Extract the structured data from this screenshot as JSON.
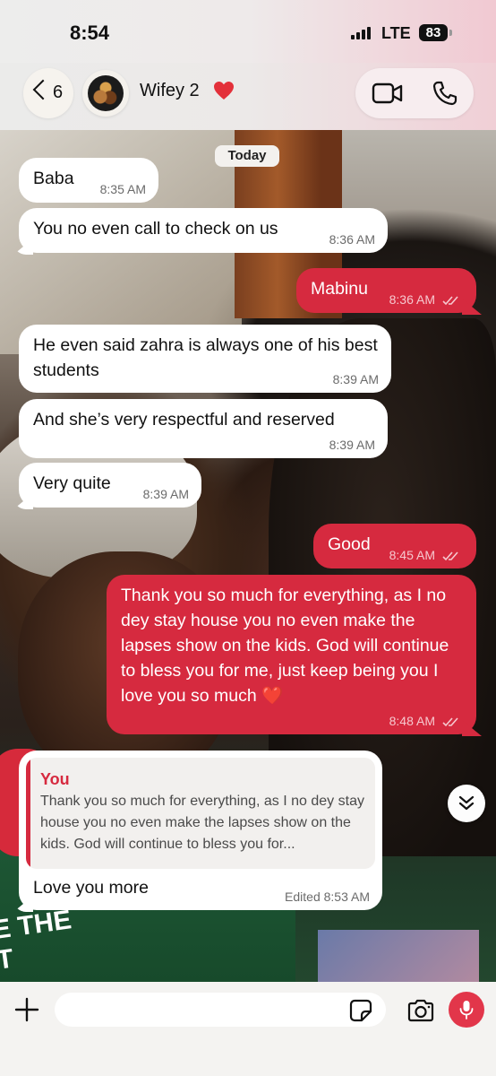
{
  "status_bar": {
    "time": "8:54",
    "network": "LTE",
    "battery": "83"
  },
  "header": {
    "back_count": "6",
    "contact_name": "Wifey 2",
    "icons": {
      "back": "chevron-left-icon",
      "name_emoji": "red-heart-icon",
      "video": "video-camera-icon",
      "call": "phone-icon"
    }
  },
  "chat": {
    "date_label": "Today",
    "messages": [
      {
        "dir": "in",
        "text": "Baba",
        "time": "8:35 AM"
      },
      {
        "dir": "in",
        "text": "You no even call to check on us",
        "time": "8:36 AM"
      },
      {
        "dir": "out",
        "text": "Mabinu",
        "time": "8:36 AM",
        "status": "read"
      },
      {
        "dir": "in",
        "text": "He even said zahra is always one of his best students",
        "time": "8:39 AM"
      },
      {
        "dir": "in",
        "text": "And she’s very respectful and reserved",
        "time": "8:39 AM"
      },
      {
        "dir": "in",
        "text": "Very quite",
        "time": "8:39 AM"
      },
      {
        "dir": "out",
        "text": "Good",
        "time": "8:45 AM",
        "status": "read"
      },
      {
        "dir": "out",
        "text": "Thank you so much for everything, as I no dey stay house you no even make the lapses show on the kids. God will continue to bless you for me, just keep being you I love you so much ❤️",
        "time": "8:48 AM",
        "status": "read"
      },
      {
        "dir": "in",
        "text": "Love you more",
        "time": "Edited 8:53 AM",
        "quote": {
          "author": "You",
          "text": "Thank you so much for everything, as I no dey stay house you no even make the lapses show on the kids. God will continue to bless you for..."
        }
      }
    ],
    "wallpaper_text": "E THE\nT"
  },
  "composer": {
    "placeholder": "",
    "icons": {
      "attach": "plus-icon",
      "sticker": "sticker-icon",
      "camera": "camera-icon",
      "mic": "microphone-icon",
      "scroll": "chevron-double-down-icon"
    }
  },
  "colors": {
    "outgoing": "#d62a3f",
    "incoming": "#ffffff",
    "accent": "#e2364a"
  }
}
